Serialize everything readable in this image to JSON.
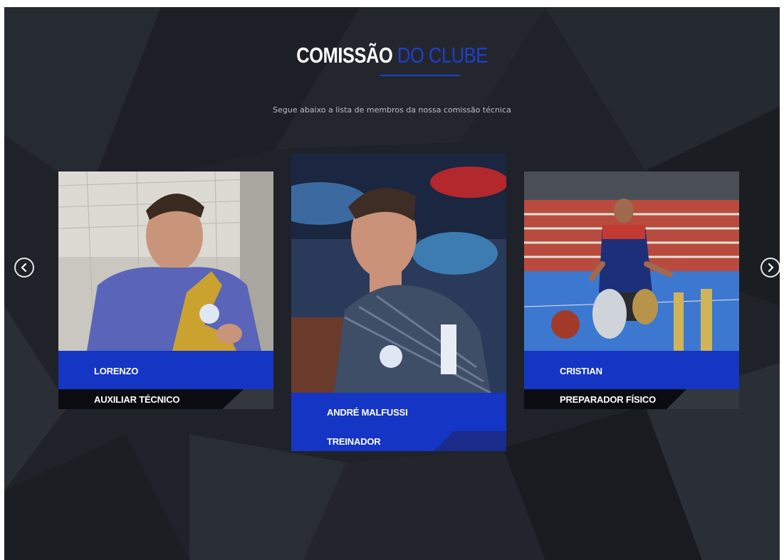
{
  "section": {
    "title_main": "COMISSÃO",
    "title_accent": "DO CLUBE",
    "subtitle": "Segue abaixo a lista de membros da nossa comissão técnica"
  },
  "carousel": {
    "prev_icon": "chevron-left-icon",
    "next_icon": "chevron-right-icon",
    "members": [
      {
        "name": "LORENZO",
        "role": "AUXILIAR TÉCNICO"
      },
      {
        "name": "ANDRÉ MALFUSSI",
        "role": "TREINADOR"
      },
      {
        "name": "CRISTIAN",
        "role": "PREPARADOR FÍSICO"
      }
    ]
  },
  "colors": {
    "accent": "#1f3fce",
    "card_bar": "#1535c4",
    "background": "#1f2228"
  }
}
